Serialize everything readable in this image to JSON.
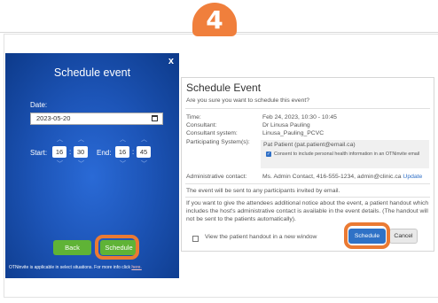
{
  "step_badge": "4",
  "modal": {
    "title": "Schedule event",
    "close": "x",
    "date_label": "Date:",
    "date_value": "2023-05-20",
    "start_label": "Start:",
    "end_label": "End:",
    "start_hour": "16",
    "start_min": "30",
    "end_hour": "16",
    "end_min": "45",
    "back_label": "Back",
    "schedule_label": "Schedule",
    "footer_text": "OTNinvite is applicable in select situations. For more info click ",
    "footer_link": "here."
  },
  "dialog": {
    "title": "Schedule Event",
    "subtitle": "Are you sure you want to schedule this event?",
    "time_label": "Time:",
    "time_value": "Feb 24, 2023, 10:30 - 10:45",
    "consultant_label": "Consultant:",
    "consultant_value": "Dr Linusa Pauling",
    "system_label": "Consultant system:",
    "system_value": "Linusa_Pauling_PCVC",
    "participating_label": "Participating System(s):",
    "participant_value": "Pat Patient (pat.patient@email.ca)",
    "consent_text": "Consent to include personal health information in an OTNinvite email",
    "admin_label": "Administrative contact:",
    "admin_value": "Ms. Admin Contact, 416-555-1234, admin@clinic.ca",
    "admin_update": "Update",
    "info_text": "The event will be sent to any participants invited by email.",
    "handout_info": "If you want to give the attendees additional notice about the event, a patient handout which includes the host's administrative contact is available in the event details. (The handout will not be sent to the patients automatically).",
    "handout_checkbox": "View the patient handout in a new window",
    "schedule_label": "Schedule",
    "cancel_label": "Cancel"
  },
  "colors": {
    "badge": "#f07f3c",
    "highlight_ring": "#ea7a33",
    "green_button": "#5fb336",
    "blue_button": "#2f72c6",
    "modal_bg": "#1d55b8"
  }
}
